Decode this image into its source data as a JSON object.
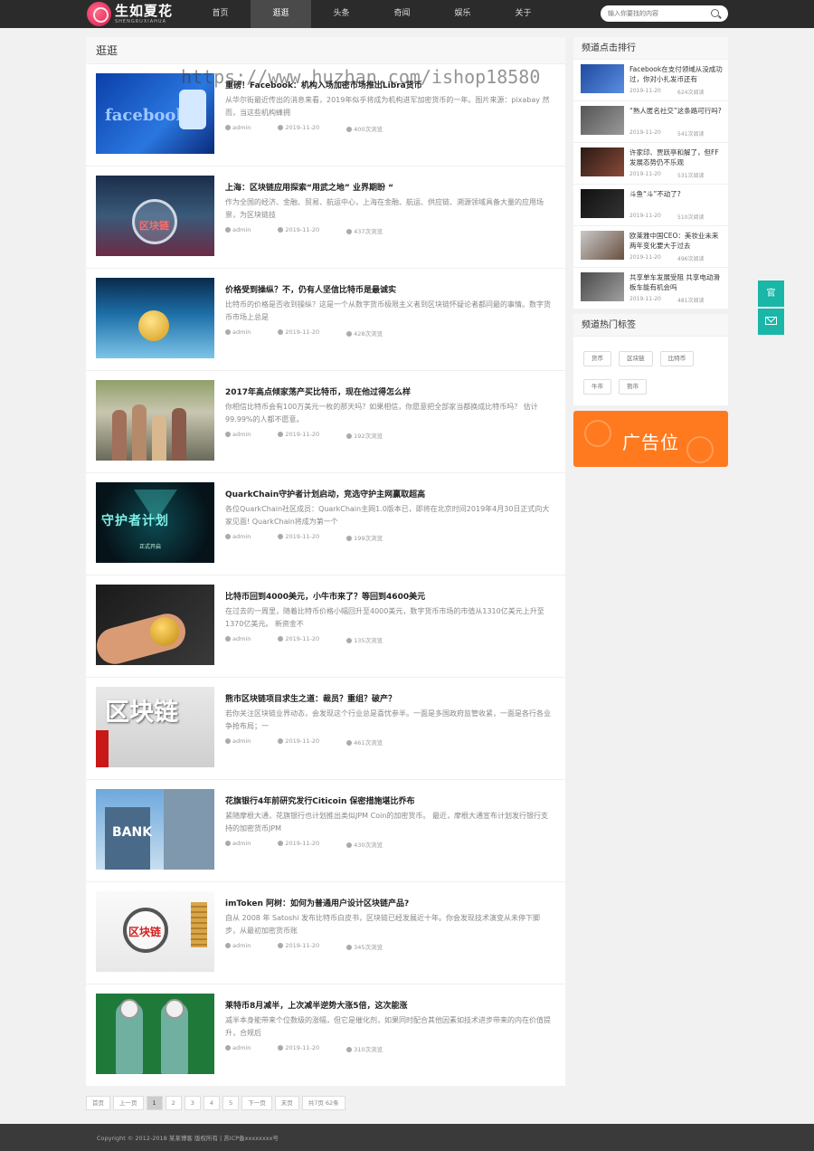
{
  "header": {
    "logo_name": "生如夏花",
    "logo_sub": "SHENGRUXIAHUA",
    "nav": [
      "首页",
      "逛逛",
      "头条",
      "奇闻",
      "娱乐",
      "关于"
    ],
    "active_nav": "逛逛",
    "search_placeholder": "输入你要找的内容"
  },
  "watermark": "https://www.huzhan.com/ishop18580",
  "main": {
    "title": "逛逛",
    "articles": [
      {
        "title": "重磅！Facebook：机构入场加密市场推出Libra货币",
        "desc": "从华尔街最近传出的消息来看，2019年似乎将成为机构进军加密货币的一年。图片来源：pixabay 然而，当这些机构蜂拥",
        "author": "admin",
        "date": "2019-11-20",
        "views": "400次浏览"
      },
      {
        "title": "上海：区块链应用探索“用武之地” 业界期盼 “",
        "desc": "作为全国的经济、金融、贸易、航运中心，上海在金融、航运、供应链、溯源领域具备大量的应用场景，为区块链技",
        "author": "admin",
        "date": "2019-11-20",
        "views": "437次浏览"
      },
      {
        "title": "价格受到操纵？不，仍有人坚信比特币是最诚实",
        "desc": "比特币的价格是否收到操纵？这是一个从数字货币极限主义者到区块链怀疑论者都问最的事情。数字货币市场上总是",
        "author": "admin",
        "date": "2019-11-20",
        "views": "428次浏览"
      },
      {
        "title": "2017年高点倾家荡产买比特币，现在他过得怎么样",
        "desc": "你相信比特币会有100万美元一枚的那天吗？如果相信，你愿意把全部家当都换成比特币吗？ 估计99.99%的人都不愿意。",
        "author": "admin",
        "date": "2019-11-20",
        "views": "192次浏览"
      },
      {
        "title": "QuarkChain守护者计划启动，竞选守护主网赢取超高",
        "desc": "各位QuarkChain社区成员：QuarkChain主网1.0版本已，即将在北京时间2019年4月30日正式向大家见面! QuarkChain将成为第一个",
        "author": "admin",
        "date": "2019-11-20",
        "views": "199次浏览"
      },
      {
        "title": "比特币回到4000美元，小牛市来了？等回到4600美元",
        "desc": "在过去的一周里，随着比特币价格小幅回升至4000美元，数字货币市场的市值从1310亿美元上升至1370亿美元。 新资金不",
        "author": "admin",
        "date": "2019-11-20",
        "views": "135次浏览"
      },
      {
        "title": "熊市区块链项目求生之道：裁员？重组？破产？",
        "desc": "若你关注区块链业界动态，会发现这个行业总是喜忧参半。一面是多国政府监管收紧，一面是各行各业争抢布局；一",
        "author": "admin",
        "date": "2019-11-20",
        "views": "461次浏览"
      },
      {
        "title": "花旗银行4年前研究发行Citicoin 保密措施堪比乔布",
        "desc": "紧随摩根大通，花旗银行也计划推出类似JPM Coin的加密货币。 最近，摩根大通宣布计划发行银行支持的加密货币JPM",
        "author": "admin",
        "date": "2019-11-20",
        "views": "430次浏览"
      },
      {
        "title": "imToken 阿树：如何为普通用户设计区块链产品?",
        "desc": "自从 2008 年 Satoshi 发布比特币白皮书，区块链已经发展近十年。你会发现技术演变从未停下脚步，从最初加密货币账",
        "author": "admin",
        "date": "2019-11-20",
        "views": "345次浏览"
      },
      {
        "title": "莱特币8月减半，上次减半逆势大涨5倍，这次能涨",
        "desc": "减半本身能带来个位数级的涨幅，但它是催化剂，如果同时配合其他因素如技术进步带来的内在价值提升，合规后",
        "author": "admin",
        "date": "2019-11-20",
        "views": "310次浏览"
      }
    ],
    "thumb_labels": {
      "t1": "facebook",
      "t2": "区块链",
      "t5": "守护者计划",
      "t5_sub": "正式开启",
      "t7": "区块链",
      "t8": "BANK",
      "t9": "区块链"
    }
  },
  "pager": {
    "items": [
      "首页",
      "上一页",
      "1",
      "2",
      "3",
      "4",
      "5",
      "下一页",
      "末页",
      "共7页 62条"
    ],
    "current": "1"
  },
  "sidebar": {
    "rank_title": "频道点击排行",
    "ranks": [
      {
        "title": "Facebook在支付领域从没成功过，你对小扎发币还有",
        "date": "2019-11-20",
        "views": "624次阅读"
      },
      {
        "title": "“熟人匿名社交”这条路可行吗?",
        "date": "2019-11-20",
        "views": "541次阅读"
      },
      {
        "title": "许家印、贾跃亭和解了，但FF发展态势仍不乐观",
        "date": "2019-11-20",
        "views": "531次阅读"
      },
      {
        "title": "斗鱼“斗”不动了?",
        "date": "2019-11-20",
        "views": "510次阅读"
      },
      {
        "title": "欧莱雅中国CEO：美妆业未来两年变化要大于过去",
        "date": "2019-11-20",
        "views": "496次阅读"
      },
      {
        "title": "共享单车发展受阻 共享电动滑板车能有机会吗",
        "date": "2019-11-20",
        "views": "481次阅读"
      }
    ],
    "tags_title": "频道热门标签",
    "tags": [
      "货币",
      "区块链",
      "比特币",
      "牛市",
      "熊市"
    ],
    "ad_text": "广告位"
  },
  "float": {
    "top_label": "官"
  },
  "footer": {
    "text": "Copyright © 2012-2018 某某博客 版权所有 | 苏ICP备xxxxxxxx号"
  },
  "colors": {
    "header_bg": "#2b2b2b",
    "accent_teal": "#1ab6a8",
    "ad_orange": "#ff7a1e"
  }
}
